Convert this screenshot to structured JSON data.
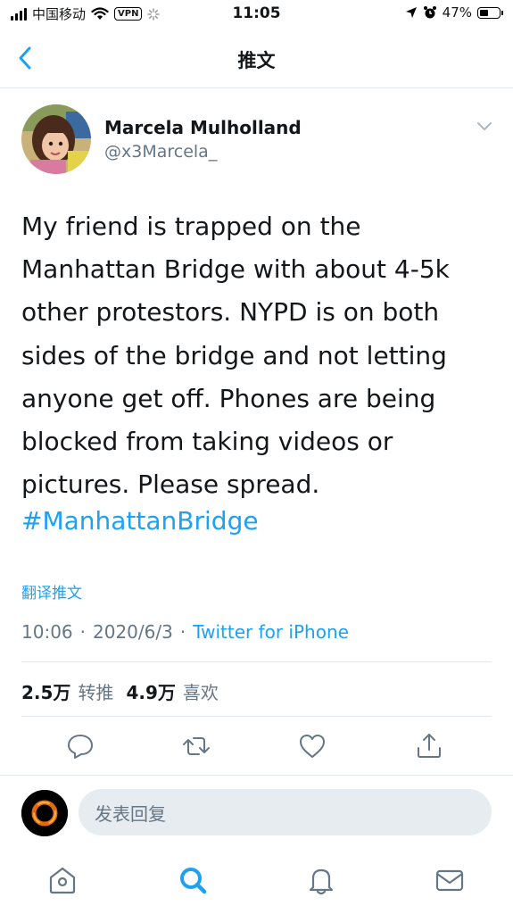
{
  "status_bar": {
    "carrier": "中国移动",
    "vpn": "VPN",
    "time": "11:05",
    "battery": "47%",
    "battery_level": 0.47
  },
  "header": {
    "title": "推文"
  },
  "tweet": {
    "author_name": "Marcela Mulholland",
    "handle": "@x3Marcela_",
    "text": "My friend is trapped on the Manhattan Bridge with about 4-5k other protestors. NYPD is on both sides of the bridge and not letting anyone get off. Phones are being blocked from taking videos or pictures. Please spread.",
    "hashtag": "#ManhattanBridge",
    "translate_label": "翻译推文",
    "time": "10:06",
    "date": "2020/6/3",
    "separator": "·",
    "source": "Twitter for iPhone",
    "retweet_count": "2.5万",
    "retweet_label": "转推",
    "like_count": "4.9万",
    "like_label": "喜欢"
  },
  "reply": {
    "placeholder": "发表回复"
  },
  "icons": {
    "back": "chevron-left-icon",
    "caret": "chevron-down-icon",
    "reply": "reply-icon",
    "retweet": "retweet-icon",
    "like": "heart-icon",
    "share": "share-icon",
    "home": "home-icon",
    "search": "search-icon",
    "notifications": "bell-icon",
    "messages": "mail-icon"
  },
  "colors": {
    "accent": "#1da1f2",
    "secondary_text": "#657786",
    "divider": "#e1e8ed",
    "reply_bg": "#e6ecf0"
  }
}
